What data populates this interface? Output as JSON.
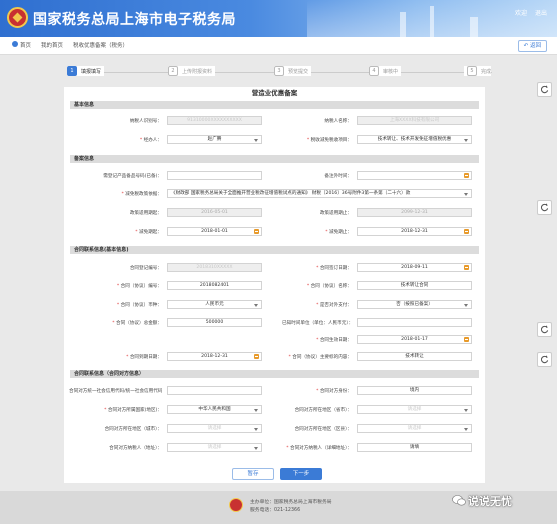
{
  "header": {
    "title": "国家税务总局上海市电子税务局",
    "links": [
      "欢迎",
      "退出"
    ]
  },
  "nav": {
    "breadcrumbs": [
      "首页",
      "我的首页",
      "税收优惠备案（税务）"
    ],
    "back_label": "返回"
  },
  "steps": [
    {
      "num": "1",
      "label": "填报填写",
      "active": true
    },
    {
      "num": "2",
      "label": "上传附报资料",
      "active": false
    },
    {
      "num": "3",
      "label": "预览提交",
      "active": false
    },
    {
      "num": "4",
      "label": "审核中",
      "active": false
    },
    {
      "num": "5",
      "label": "完成",
      "active": false
    }
  ],
  "page_title": "营造业优惠备案",
  "sections": {
    "basic": "基本信息",
    "filing": "备案信息",
    "contract": "合同联系信息(基本信息)",
    "contract2": "合同联系信息（合同对方信息）"
  },
  "basic": {
    "taxpayer_id_label": "纳税人识别号：",
    "taxpayer_id": "91310000XXXXXXXXXX",
    "taxpayer_name_label": "纳税人名称：",
    "taxpayer_name": "上海XXXX科技有限公司",
    "agent_label": "经办人：",
    "agent": "赵广腾",
    "tax_item_label": "税收减免税收项目：",
    "tax_item": "技术转让、技术开发免征增值税优惠"
  },
  "filing": {
    "prior_label": "需登记产品备品号码(已备)：",
    "prior_value": "",
    "prior_date_label": "备注外时间：",
    "policy_label": "减免税政策依据：",
    "policy": "《财政部 国家税务总局关于全面推开营业税改征增值税试点的通知》 财税〔2016〕36号附件3第一条第（二十六）款",
    "reg_start_label": "政策适用期起：",
    "reg_start": "2016-05-01",
    "reg_end_label": "政策适用期止：",
    "reg_end": "2099-12-31",
    "start_label": "减免期起：",
    "start_date": "2018-01-01",
    "end_label": "减免期止：",
    "end_date": "2018-12-31"
  },
  "contract": {
    "reg_no_label": "合同登记编号：",
    "reg_no": "2018310XXXXX",
    "sign_date_label": "合同签订日期：",
    "sign_date": "2018-09-11",
    "contract_no_label": "合同（协议）编号：",
    "contract_no": "2018082401",
    "name_label": "合同（协议）名称：",
    "name": "技术转让合同",
    "currency_label": "合同（协议）币种：",
    "currency": "人民币元",
    "foreign_label": "是否对外支付：",
    "foreign": "否（按照已备案）",
    "amount_label": "合同（协议）总金额：",
    "amount": "500000",
    "period_label": "已知时间单位（单位：人民币元）：",
    "period": "",
    "effect_label": "合同生效日期：",
    "effect_date": "2018-01-17",
    "expire_label": "合同到期日期：",
    "expire_date": "2018-12-31",
    "subject_label": "合同（协议）主要标的内容：",
    "subject": "技术转让"
  },
  "contract2": {
    "other_id_label": "合同对方统一社会信用代码/统一社会信用代码：",
    "other_id": "",
    "party_type_label": "合同对方身份：",
    "party_type": "境内",
    "country_label": "合同对方所属国家(地区)：",
    "country": "中华人民共和国",
    "region_label": "合同对方所在地区（省市）：",
    "region": "请选择",
    "city_label": "合同对方所在地区（城市）：",
    "city": "请选择",
    "district_label": "合同对方所在地区（区县）：",
    "district": "请选择",
    "tel_label": "合同对方纳税人（地址）：",
    "tel": "请选择",
    "address_label": "合同对方纳税人（详细地址）：",
    "address": "请填"
  },
  "buttons": {
    "save": "暂存",
    "next": "下一步"
  },
  "footer": {
    "host": "主办单位：国家税务总局上海市税务局",
    "tel": "服务电话：021-12366"
  },
  "watermark": "说说无忧",
  "colors": {
    "primary": "#3b7bd6",
    "required": "#e03b3b",
    "calendar": "#e89a2a"
  }
}
